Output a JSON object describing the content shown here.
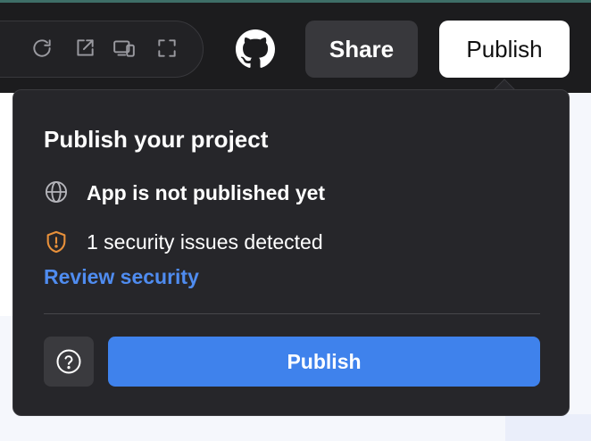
{
  "topbar": {
    "icons": [
      "reload-icon",
      "open-external-icon",
      "device-preview-icon",
      "fullscreen-icon",
      "github-icon"
    ],
    "share_label": "Share",
    "publish_label": "Publish"
  },
  "popover": {
    "title": "Publish your project",
    "status_text": "App is not published yet",
    "security_text": "1 security issues detected",
    "review_link": "Review security",
    "publish_button": "Publish",
    "help_icon": "help-circle-icon"
  },
  "colors": {
    "accent": "#3f82ec",
    "link": "#4f8cf0",
    "warning": "#e8903a",
    "topbar_bg": "#1c1c1e",
    "popover_bg": "#26262a"
  }
}
